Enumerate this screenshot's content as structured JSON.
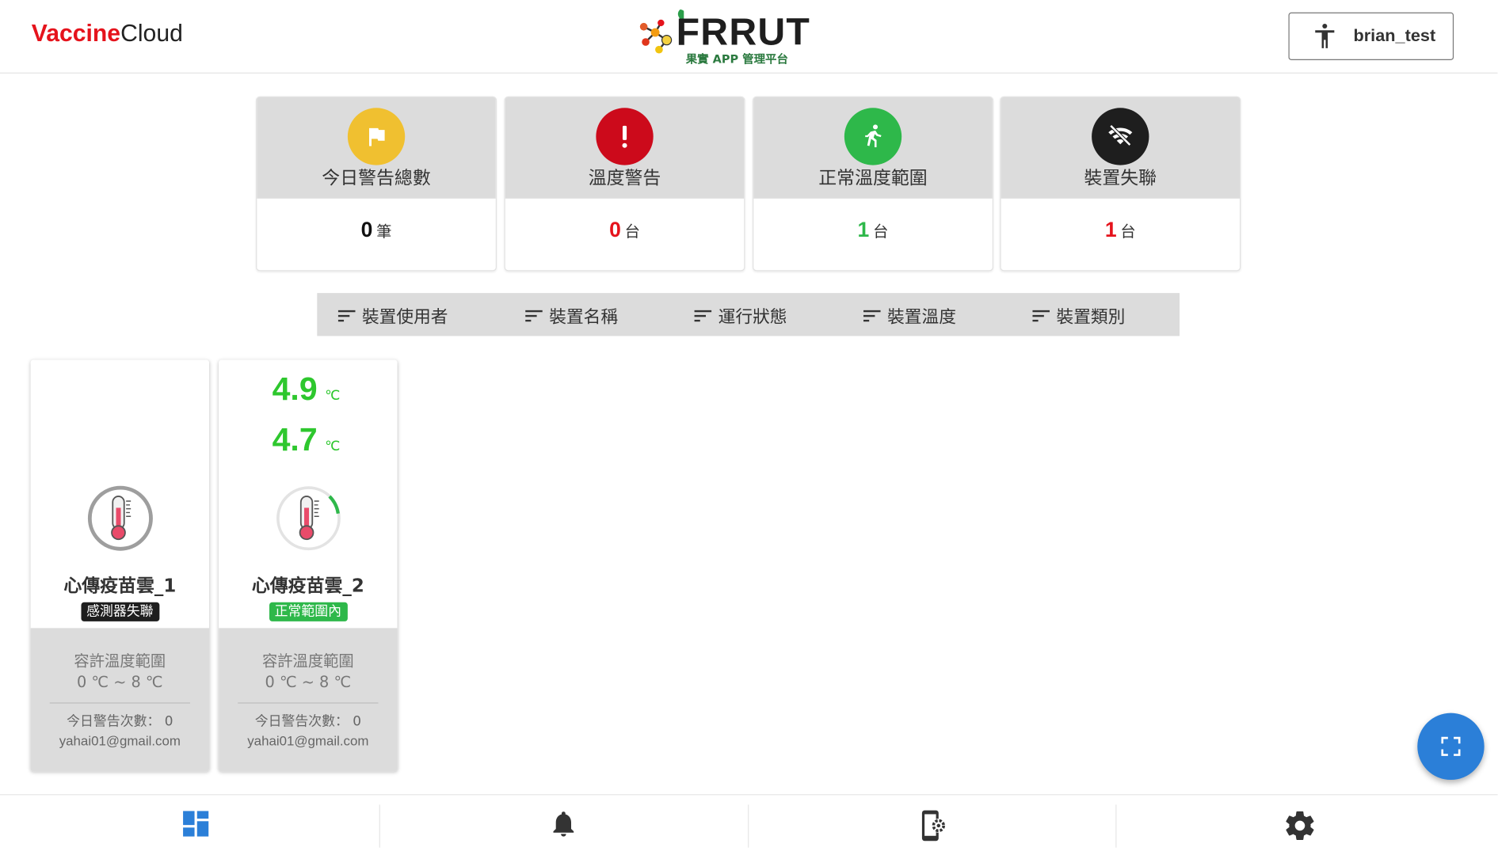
{
  "header": {
    "brand_part1": "Vaccine",
    "brand_part2": "Cloud",
    "logo_text": "FRRUT",
    "logo_subtitle": "果實 APP 管理平台",
    "user_name": "brian_test"
  },
  "summary": [
    {
      "title": "今日警告總數",
      "value": "0",
      "unit": "筆",
      "color": "#f0c030",
      "value_color": "#111111",
      "icon": "flag-icon"
    },
    {
      "title": "溫度警告",
      "value": "0",
      "unit": "台",
      "color": "#cc0a1b",
      "value_color": "#e5131c",
      "icon": "exclamation-icon"
    },
    {
      "title": "正常溫度範圍",
      "value": "1",
      "unit": "台",
      "color": "#2eb84a",
      "value_color": "#2eb84a",
      "icon": "running-person-icon"
    },
    {
      "title": "裝置失聯",
      "value": "1",
      "unit": "台",
      "color": "#1e1e1e",
      "value_color": "#e5131c",
      "icon": "wifi-off-icon"
    }
  ],
  "sort_bar": [
    "裝置使用者",
    "裝置名稱",
    "運行狀態",
    "裝置溫度",
    "裝置類別"
  ],
  "devices": [
    {
      "temp1": "",
      "temp2": "",
      "temp_unit": "",
      "name": "心傳疫苗雲_1",
      "status": "感測器失聯",
      "status_color": "#1e1e1e",
      "range_label": "容許溫度範圍",
      "range_value": "0 ℃ ~ 8 ℃",
      "alert_count": "今日警告次數： 0",
      "email": "yahai01@gmail.com"
    },
    {
      "temp1": "4.9",
      "temp2": "4.7",
      "temp_unit": "℃",
      "name": "心傳疫苗雲_2",
      "status": "正常範圍內",
      "status_color": "#2eb84a",
      "range_label": "容許溫度範圍",
      "range_value": "0 ℃ ~ 8 ℃",
      "alert_count": "今日警告次數： 0",
      "email": "yahai01@gmail.com"
    }
  ],
  "colors": {
    "accent_blue": "#2b7fd8",
    "temp_green": "#2ec72e",
    "brand_red": "#e5131c"
  },
  "nav": [
    "dashboard-icon",
    "bell-icon",
    "device-settings-icon",
    "gear-icon"
  ]
}
